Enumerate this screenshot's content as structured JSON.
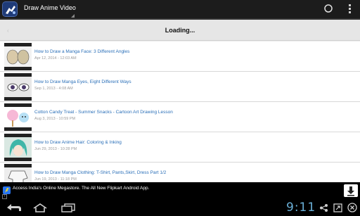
{
  "app": {
    "title": "Draw Anime Video",
    "icon": "app-logo-icon"
  },
  "toolbar": {
    "spinner_icon": "loading-circle-icon",
    "overflow_icon": "overflow-menu-icon"
  },
  "loading": {
    "text": "Loading...",
    "back_label": "‹"
  },
  "videos": [
    {
      "title": "How to Draw a Manga Face: 3 Different Angles",
      "date": "Apr 12, 2014 - 12:03 AM"
    },
    {
      "title": "How to Draw Manga Eyes, Eight Different Ways",
      "date": "Sep 1, 2013 - 4:08 AM"
    },
    {
      "title": "Cotton Candy Treat - Summer Snacks - Cartoon Art Drawing Lesson",
      "date": "Aug 3, 2013 - 10:59 PM"
    },
    {
      "title": "How to Draw Anime Hair: Coloring & Inking",
      "date": "Jun 29, 2013 - 10:28 PM"
    },
    {
      "title": "How to Draw Manga Clothing: T-Shirt, Pants,Skirt, Dress Part 1/2",
      "date": "Jun 19, 2013 - 11:18 PM"
    }
  ],
  "ad": {
    "text": "Access India's Online Megastore. The All New Flipkart Android App.",
    "info_label": "i",
    "download_icon": "download-icon"
  },
  "system": {
    "clock": "9:11",
    "colors": {
      "clock": "#6ab0d8",
      "link": "#2a6fb8"
    }
  }
}
